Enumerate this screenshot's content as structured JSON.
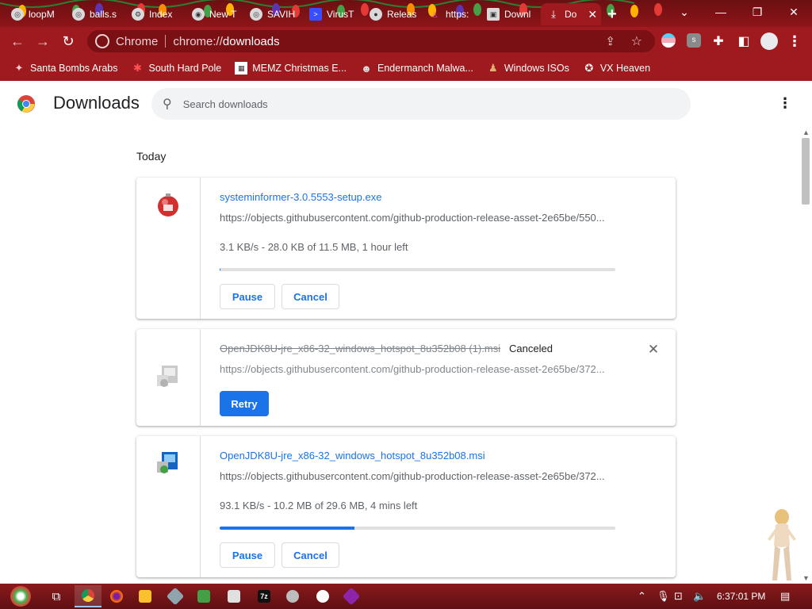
{
  "browser": {
    "tabs": [
      {
        "label": "loopM",
        "icon": "web-icon"
      },
      {
        "label": "balls.s",
        "icon": "web-icon"
      },
      {
        "label": "Index",
        "icon": "web-icon"
      },
      {
        "label": "New T",
        "icon": "chrome-icon"
      },
      {
        "label": "SAVIH",
        "icon": "web-icon"
      },
      {
        "label": "VirusT",
        "icon": "virustotal-icon"
      },
      {
        "label": "Releas",
        "icon": "github-icon"
      },
      {
        "label": "https:",
        "icon": "web-icon"
      },
      {
        "label": "Downl",
        "icon": "web-icon"
      },
      {
        "label": "Do",
        "icon": "download-icon",
        "active": true
      }
    ],
    "new_tab": "+",
    "tab_close": "✕",
    "window_controls": {
      "minimize": "—",
      "restore": "❐",
      "close": "✕",
      "tab_search": "⌄"
    }
  },
  "toolbar": {
    "omnibox_site": "Chrome",
    "omnibox_url_scheme": "chrome://",
    "omnibox_url_host": "downloads"
  },
  "bookmarks": [
    {
      "label": "Santa Bombs Arabs",
      "icon": "santa-icon"
    },
    {
      "label": "South Hard Pole",
      "icon": "snowflake-icon"
    },
    {
      "label": "MEMZ Christmas E...",
      "icon": "memz-icon"
    },
    {
      "label": "Endermanch Malwa...",
      "icon": "raccoon-icon"
    },
    {
      "label": "Windows ISOs",
      "icon": "figure-icon"
    },
    {
      "label": "VX Heaven",
      "icon": "vx-icon"
    }
  ],
  "downloads": {
    "title": "Downloads",
    "search_placeholder": "Search downloads",
    "date_heading": "Today",
    "items": [
      {
        "filename": "systeminformer-3.0.5553-setup.exe",
        "url": "https://objects.githubusercontent.com/github-production-release-asset-2e65be/550...",
        "progress_text": "3.1 KB/s - 28.0 KB of 11.5 MB, 1 hour left",
        "progress_fraction": 0.002,
        "buttons": [
          "Pause",
          "Cancel"
        ],
        "state": "in-progress"
      },
      {
        "filename": "OpenJDK8U-jre_x86-32_windows_hotspot_8u352b08 (1).msi",
        "status": "Canceled",
        "url": "https://objects.githubusercontent.com/github-production-release-asset-2e65be/372...",
        "buttons": [
          "Retry"
        ],
        "state": "canceled"
      },
      {
        "filename": "OpenJDK8U-jre_x86-32_windows_hotspot_8u352b08.msi",
        "url": "https://objects.githubusercontent.com/github-production-release-asset-2e65be/372...",
        "progress_text": "93.1 KB/s - 10.2 MB of 29.6 MB, 4 mins left",
        "progress_fraction": 0.34,
        "buttons": [
          "Pause",
          "Cancel"
        ],
        "state": "in-progress"
      }
    ]
  },
  "taskbar": {
    "clock": "6:37:01 PM",
    "apps": [
      "task-view",
      "chrome",
      "firefox",
      "file-explorer",
      "app5",
      "app6",
      "7zip",
      "app8",
      "app9",
      "app10"
    ]
  },
  "colors": {
    "accent": "#1a73e8",
    "frame": "#9e1a1e",
    "taskbar": "#7c1518"
  }
}
